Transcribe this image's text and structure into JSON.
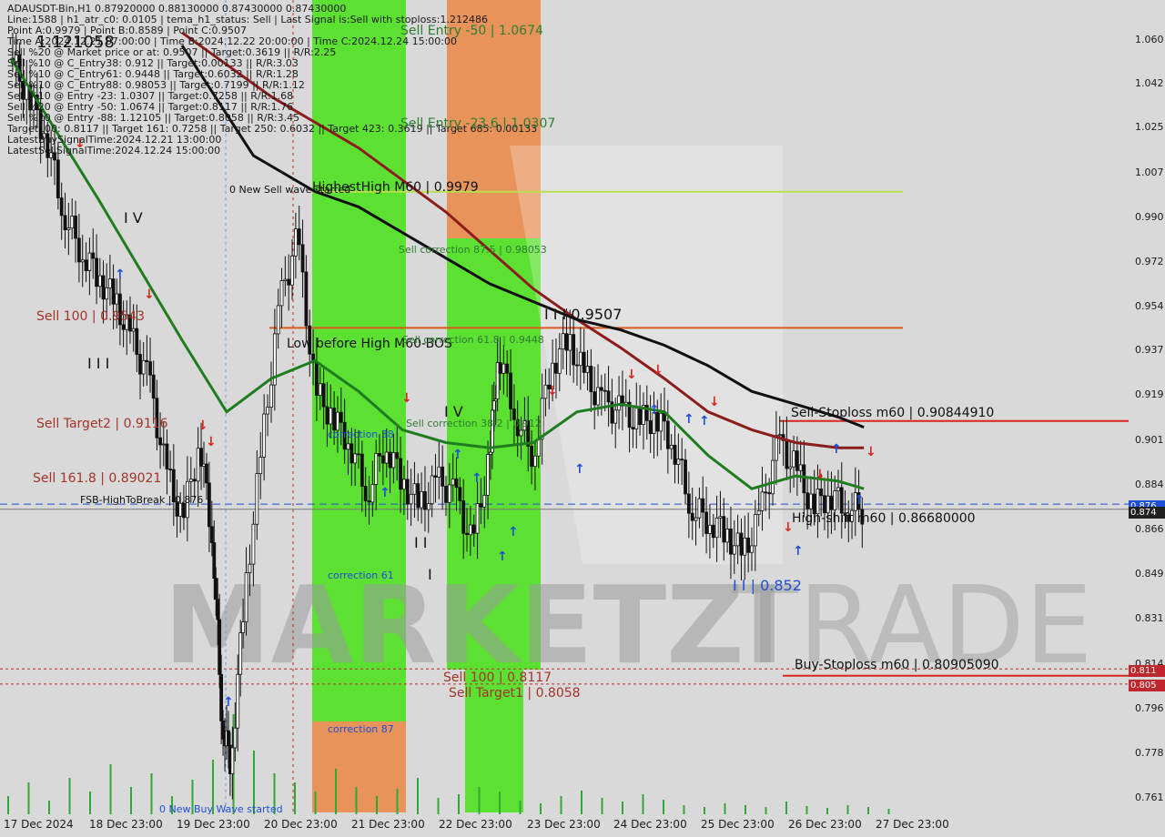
{
  "header": {
    "lines": [
      "ADAUSDT-Bin,H1  0.87920000 0.88130000 0.87430000 0.87430000",
      "Line:1588 | h1_atr_c0: 0.0105 | tema_h1_status: Sell | Last Signal is:Sell with stoploss:1.212486",
      "Point A:0.9979 | Point B:0.8589 | Point C:0.9507",
      "Time A:2024.12.21 07:00:00 | Time B:2024.12.22 20:00:00 | Time C:2024.12.24 15:00:00",
      "Sell %20 @ Market price or at: 0.9507 || Target:0.3619 || R/R:2.25",
      "Sell %10 @ C_Entry38: 0.912 || Target:0.00133 || R/R:3.03",
      "Sell %10 @ C_Entry61: 0.9448 || Target:0.6032 || R/R:1.28",
      "Sell %10 @ C_Entry88: 0.98053 || Target:0.7199 || R/R:1.12",
      "Sell %10 @ Entry -23: 1.0307 || Target:0.7258 || R/R:1.68",
      "Sell %20 @ Entry -50: 1.0674 || Target:0.8117 || R/R:1.76",
      "Sell %20 @ Entry -88: 1.12105 || Target:0.8058 || R/R:3.45",
      "Target100: 0.8117 || Target 161: 0.7258 || Target 250: 0.6032 || Target 423: 0.3619 || Target 685: 0.00133",
      "LatestBuySignalTime:2024.12.21 13:00:00",
      "LatestSellSignalTime:2024.12.24 15:00:00"
    ]
  },
  "labels": {
    "big_price": "1.121058",
    "sell_entry_50": "Sell Entry -50 | 1.0674",
    "sell_entry_23": "Sell Entry -23.6 | 1.0307",
    "highest_high": "HighestHigh   M60 | 0.9979",
    "new_sell_wave": "0 New Sell wave started",
    "sell_corr_875": "Sell correction 87.5 | 0.98053",
    "iv_top": "I V",
    "point_c": "I I I 0.9507",
    "sell_100_left": "Sell 100 | 0.9543",
    "low_before_high": "Low before High   M60-BOS",
    "sell_corr_618": "Sell correction 61.8 | 0.9448",
    "iii_left": "I I I",
    "sell_target2": "Sell Target2 | 0.9116",
    "iv_mid": "I V",
    "sell_corr_382": "Sell correction 38.2 | 0.912",
    "correction_38": "correction 38",
    "sell_1618": "Sell 161.8 | 0.89021",
    "fsb": "FSB-HighToBreak | 0.876",
    "ii_mid": "I I",
    "i_mid": "I",
    "correction_61": "correction 61",
    "correction_87": "correction 87",
    "sell_100_bottom": "Sell 100 | 0.8117",
    "sell_target1": "Sell Target1 | 0.8058",
    "new_buy_wave": "0 New Buy Wave started",
    "point_b": "I I | 0.852",
    "sell_stoploss": "Sell-Stoploss m60 | 0.90844910",
    "high_shift": "High-shift m60 | 0.86680000",
    "buy_stoploss": "Buy-Stoploss m60 | 0.80905090",
    "watermark_a": "MARKETZI",
    "watermark_b": "TRADE"
  },
  "price_axis": [
    "1.060",
    "1.042",
    "1.025",
    "1.007",
    "0.990",
    "0.972",
    "0.954",
    "0.937",
    "0.919",
    "0.901",
    "0.884",
    "0.866",
    "0.849",
    "0.831",
    "0.814",
    "0.796",
    "0.778",
    "0.761"
  ],
  "price_tags": [
    {
      "text": "0.876",
      "color": "#1f4fd6"
    },
    {
      "text": "0.874",
      "color": "#202020"
    },
    {
      "text": "0.811",
      "color": "#c0272d"
    },
    {
      "text": "0.805",
      "color": "#c0272d"
    }
  ],
  "date_axis": [
    "17 Dec 2024",
    "18 Dec 23:00",
    "19 Dec 23:00",
    "20 Dec 23:00",
    "21 Dec 23:00",
    "22 Dec 23:00",
    "23 Dec 23:00",
    "24 Dec 23:00",
    "25 Dec 23:00",
    "26 Dec 23:00",
    "27 Dec 23:00"
  ],
  "colors": {
    "background": "#d9d9d9",
    "zone_green": "#5ce032",
    "zone_orange": "#e8935a",
    "ma_green": "#1f7d1f",
    "ma_darkred": "#8c1d1d",
    "ma_black": "#101010",
    "level_red": "#d9261c",
    "level_lime": "#b7e04c",
    "buy_arrow": "#1f4fd6",
    "sell_arrow": "#d9261c"
  },
  "chart_data": {
    "type": "candlestick",
    "symbol": "ADAUSDT-Bin",
    "timeframe": "H1",
    "ylim": [
      0.755,
      1.072
    ],
    "x_dates": [
      "17 Dec 2024",
      "18 Dec 23:00",
      "19 Dec 23:00",
      "20 Dec 23:00",
      "21 Dec 23:00",
      "22 Dec 23:00",
      "23 Dec 23:00",
      "24 Dec 23:00",
      "25 Dec 23:00",
      "26 Dec 23:00",
      "27 Dec 23:00"
    ],
    "close_path": [
      [
        0,
        1.05
      ],
      [
        0.2,
        1.035
      ],
      [
        0.4,
        1.02
      ],
      [
        0.6,
        0.99
      ],
      [
        0.8,
        0.975
      ],
      [
        1.0,
        0.965
      ],
      [
        1.2,
        0.955
      ],
      [
        1.4,
        0.94
      ],
      [
        1.6,
        0.925
      ],
      [
        1.8,
        0.89
      ],
      [
        2.0,
        0.87
      ],
      [
        2.2,
        0.9
      ],
      [
        2.35,
        0.86
      ],
      [
        2.45,
        0.79
      ],
      [
        2.55,
        0.775
      ],
      [
        2.7,
        0.84
      ],
      [
        2.9,
        0.9
      ],
      [
        3.1,
        0.955
      ],
      [
        3.3,
        0.98
      ],
      [
        3.5,
        0.92
      ],
      [
        3.7,
        0.91
      ],
      [
        3.9,
        0.9
      ],
      [
        4.1,
        0.88
      ],
      [
        4.3,
        0.9
      ],
      [
        4.5,
        0.885
      ],
      [
        4.7,
        0.875
      ],
      [
        4.9,
        0.885
      ],
      [
        5.1,
        0.88
      ],
      [
        5.3,
        0.86
      ],
      [
        5.5,
        0.895
      ],
      [
        5.6,
        0.935
      ],
      [
        5.8,
        0.91
      ],
      [
        6.0,
        0.895
      ],
      [
        6.2,
        0.93
      ],
      [
        6.4,
        0.94
      ],
      [
        6.6,
        0.925
      ],
      [
        6.8,
        0.915
      ],
      [
        7.0,
        0.912
      ],
      [
        7.2,
        0.908
      ],
      [
        7.4,
        0.91
      ],
      [
        7.6,
        0.9
      ],
      [
        7.8,
        0.875
      ],
      [
        8.0,
        0.87
      ],
      [
        8.2,
        0.865
      ],
      [
        8.4,
        0.856
      ],
      [
        8.6,
        0.872
      ],
      [
        8.8,
        0.9
      ],
      [
        9.0,
        0.89
      ],
      [
        9.2,
        0.875
      ],
      [
        9.4,
        0.88
      ],
      [
        9.6,
        0.875
      ],
      [
        9.8,
        0.874
      ]
    ],
    "series": [
      {
        "name": "",
        "color": "#1f7d1f",
        "points": [
          [
            0,
            1.05
          ],
          [
            1.0,
            0.995
          ],
          [
            2.0,
            0.94
          ],
          [
            2.5,
            0.912
          ],
          [
            3.0,
            0.925
          ],
          [
            3.5,
            0.932
          ],
          [
            4.0,
            0.92
          ],
          [
            4.5,
            0.905
          ],
          [
            5.0,
            0.9
          ],
          [
            5.5,
            0.898
          ],
          [
            6.0,
            0.9
          ],
          [
            6.5,
            0.912
          ],
          [
            7.0,
            0.915
          ],
          [
            7.5,
            0.912
          ],
          [
            8.0,
            0.895
          ],
          [
            8.5,
            0.882
          ],
          [
            9.0,
            0.887
          ],
          [
            9.5,
            0.885
          ],
          [
            9.8,
            0.882
          ]
        ]
      },
      {
        "name": "",
        "color": "#8c1d1d",
        "points": [
          [
            2.0,
            1.06
          ],
          [
            3.0,
            1.035
          ],
          [
            4.0,
            1.015
          ],
          [
            5.0,
            0.99
          ],
          [
            6.0,
            0.96
          ],
          [
            6.5,
            0.948
          ],
          [
            7.0,
            0.937
          ],
          [
            7.5,
            0.925
          ],
          [
            8.0,
            0.912
          ],
          [
            8.5,
            0.905
          ],
          [
            9.0,
            0.9
          ],
          [
            9.5,
            0.898
          ],
          [
            9.8,
            0.898
          ]
        ]
      },
      {
        "name": "",
        "color": "#101010",
        "points": [
          [
            2.0,
            1.055
          ],
          [
            2.8,
            1.012
          ],
          [
            3.5,
            0.998
          ],
          [
            4.0,
            0.992
          ],
          [
            5.0,
            0.972
          ],
          [
            5.5,
            0.962
          ],
          [
            6.0,
            0.955
          ],
          [
            6.5,
            0.948
          ],
          [
            7.0,
            0.944
          ],
          [
            7.5,
            0.938
          ],
          [
            8.0,
            0.93
          ],
          [
            8.5,
            0.92
          ],
          [
            9.0,
            0.915
          ],
          [
            9.5,
            0.91
          ],
          [
            9.8,
            0.906
          ]
        ]
      }
    ],
    "levels": [
      {
        "label": "Sell Entry -50",
        "value": 1.0674
      },
      {
        "label": "Sell Entry -23.6",
        "value": 1.0307
      },
      {
        "label": "HighestHigh M60",
        "value": 0.9979
      },
      {
        "label": "Sell correction 87.5",
        "value": 0.98053
      },
      {
        "label": "Sell correction 61.8",
        "value": 0.9448
      },
      {
        "label": "Sell correction 38.2",
        "value": 0.912
      },
      {
        "label": "Sell-Stoploss m60",
        "value": 0.9084491
      },
      {
        "label": "FSB-HighToBreak",
        "value": 0.876
      },
      {
        "label": "High-shift m60",
        "value": 0.8668
      },
      {
        "label": "Sell 100",
        "value": 0.8117
      },
      {
        "label": "Buy-Stoploss m60",
        "value": 0.8090509
      },
      {
        "label": "Sell Target1",
        "value": 0.8058
      }
    ],
    "volume": [
      20,
      35,
      15,
      40,
      25,
      55,
      30,
      45,
      20,
      38,
      60,
      110,
      70,
      45,
      35,
      25,
      50,
      30,
      20,
      28,
      40,
      18,
      22,
      30,
      25,
      15,
      12,
      20,
      26,
      18,
      14,
      22,
      16,
      10,
      8,
      12,
      10,
      8,
      14,
      9,
      7,
      10,
      8,
      6
    ]
  }
}
